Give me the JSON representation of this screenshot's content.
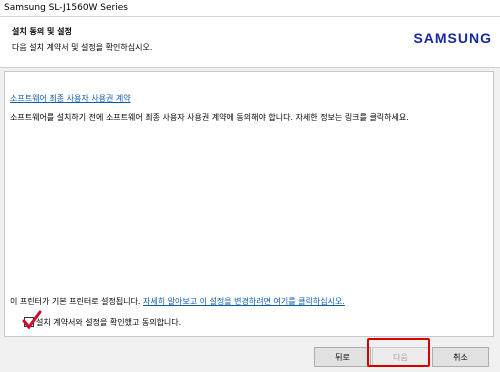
{
  "window": {
    "title": "Samsung SL-J1560W Series"
  },
  "header": {
    "title": "설치 동의 및 설정",
    "subtitle": "다음 설치 계약서 및 설정을 확인하십시오.",
    "brand": "SAMSUNG",
    "brand_color": "#1428a0"
  },
  "content": {
    "eula_link": "소프트웨어 최종 사용자 사용권 계약",
    "eula_description": "소프트웨어를 설치하기 전에 소프트웨어 최종 사용자 사용권 계약에 동의해야 합니다. 자세한 정보는 링크를 클릭하세요.",
    "default_printer_text": "이 프린터가 기본 프린터로 설정됩니다. ",
    "default_printer_link": "자세히 알아보고 이 설정을 변경하려면 여기를 클릭하십시오.",
    "agree_label": "설치 계약서와 설정을 확인했고 동의합니다.",
    "agree_checked": true,
    "link_color": "#0b5cad"
  },
  "footer": {
    "back_label": "뒤로",
    "next_label": "다음",
    "next_enabled": false,
    "cancel_label": "취소",
    "highlight_color": "#d40000"
  }
}
